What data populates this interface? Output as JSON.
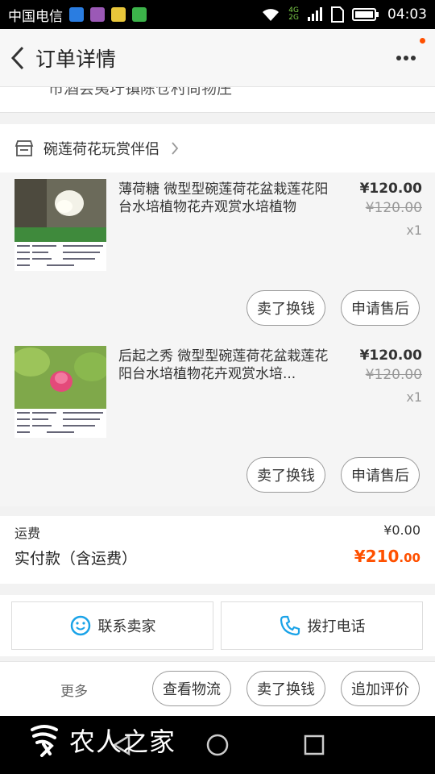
{
  "status_bar": {
    "carrier": "中国电信",
    "time": "04:03",
    "net_top": "4G",
    "net_bottom": "2G"
  },
  "header": {
    "title": "订单详情"
  },
  "address": {
    "partial_text": "市酒会夷圩镇陈仓村尚物庄"
  },
  "shop": {
    "name": "碗莲荷花玩赏伴侣"
  },
  "items": [
    {
      "title": "薄荷糖 微型型碗莲荷花盆栽莲花阳台水培植物花卉观赏水培植物",
      "price": "¥120.00",
      "original_price": "¥120.00",
      "quantity": "x1",
      "actions": [
        "卖了换钱",
        "申请售后"
      ]
    },
    {
      "title": "后起之秀 微型型碗莲荷花盆栽莲花阳台水培植物花卉观赏水培...",
      "price": "¥120.00",
      "original_price": "¥120.00",
      "quantity": "x1",
      "actions": [
        "卖了换钱",
        "申请售后"
      ]
    }
  ],
  "summary": {
    "shipping_label": "运费",
    "shipping_value": "¥0.00",
    "total_label": "实付款（含运费）",
    "total_main": "¥210",
    "total_decimal": ".00"
  },
  "contact": {
    "seller_label": "联系卖家",
    "call_label": "拨打电话"
  },
  "bottom_bar": {
    "more_label": "更多",
    "buttons": [
      "查看物流",
      "卖了换钱",
      "追加评价"
    ]
  },
  "watermark": {
    "text": "农人之家"
  },
  "colors": {
    "accent": "#ff5000",
    "icon_blue": "#1aa3e8"
  }
}
